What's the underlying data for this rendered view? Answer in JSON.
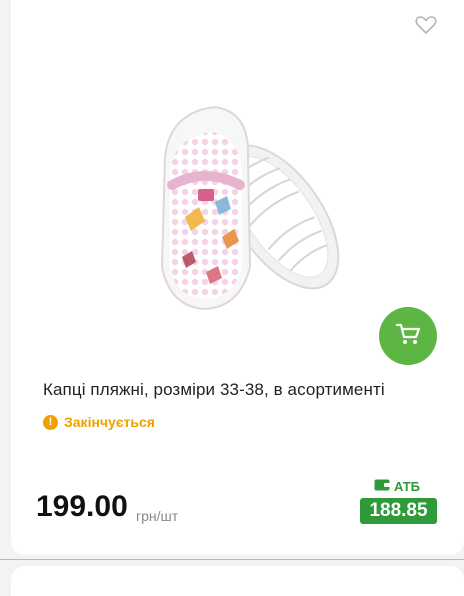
{
  "product": {
    "title": "Капці пляжні, розміри 33-38, в асортименті",
    "status": "Закінчується",
    "price": "199.00",
    "unit": "грн/шт",
    "atb_label": "АТБ",
    "atb_price": "188.85"
  },
  "icons": {
    "favorite": "heart-outline-icon",
    "cart": "cart-icon",
    "status": "exclamation-icon",
    "wallet": "wallet-icon"
  },
  "colors": {
    "accent_green": "#5db543",
    "atb_green": "#2f9a3a",
    "status_orange": "#f0a000",
    "divider_yellow": "#f0c000"
  }
}
